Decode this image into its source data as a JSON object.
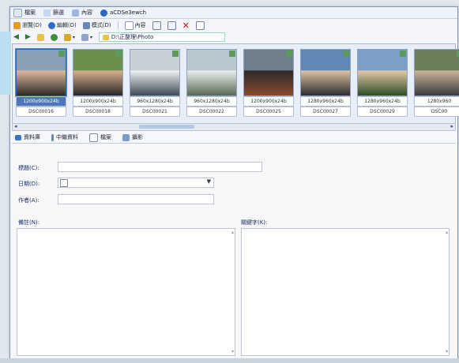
{
  "menu": {
    "items": [
      {
        "icon": "file-icon",
        "label": "檔案"
      },
      {
        "icon": "filter-icon",
        "label": "篩選"
      },
      {
        "icon": "view-icon",
        "label": "內容"
      },
      {
        "icon": "acdsee-icon",
        "label": "aCDSe3ewch"
      }
    ]
  },
  "toolbar": {
    "row1": [
      {
        "icon": "browse-icon",
        "label": "瀏覽(D)"
      },
      {
        "icon": "edit-icon",
        "label": "編輯(D)"
      },
      {
        "icon": "view-mode-icon",
        "label": "模式(D)"
      },
      {
        "icon": "info-icon",
        "label": "內容"
      },
      {
        "icon": "copy-icon",
        "label": ""
      },
      {
        "icon": "paste-icon",
        "label": ""
      },
      {
        "icon": "delete-icon",
        "label": ""
      },
      {
        "icon": "properties-icon",
        "label": ""
      }
    ],
    "path": "D:\\正整理\\Photo"
  },
  "thumbnails": [
    {
      "dims": "1200x900x24b",
      "name": "DSC00016",
      "selected": true
    },
    {
      "dims": "1200x900x24b",
      "name": "DSC00018",
      "selected": false
    },
    {
      "dims": "960x1280x24b",
      "name": "DSC00021",
      "selected": false
    },
    {
      "dims": "960x1280x24b",
      "name": "DSC00022",
      "selected": false
    },
    {
      "dims": "1200x900x24b",
      "name": "DSC00025",
      "selected": false
    },
    {
      "dims": "1280x960x24b",
      "name": "DSC00027",
      "selected": false
    },
    {
      "dims": "1280x960x24b",
      "name": "DSC00029",
      "selected": false
    },
    {
      "dims": "1280x960",
      "name": "DSC00",
      "selected": false
    }
  ],
  "tabs": [
    {
      "icon": "database-icon",
      "label": "資料庫"
    },
    {
      "icon": "metadata-icon",
      "label": "中繼資料"
    },
    {
      "icon": "file-tab-icon",
      "label": "檔案"
    },
    {
      "icon": "photo-icon",
      "label": "攝影"
    }
  ],
  "form": {
    "title_label": "標題(C):",
    "date_label": "日期(D):",
    "author_label": "作者(A):",
    "notes_label": "備註(N):",
    "keywords_label": "關鍵字(K):",
    "title_value": "",
    "date_value": "",
    "author_value": ""
  },
  "colors": {
    "selection": "#4d77bd",
    "accent": "#2c61b8"
  }
}
